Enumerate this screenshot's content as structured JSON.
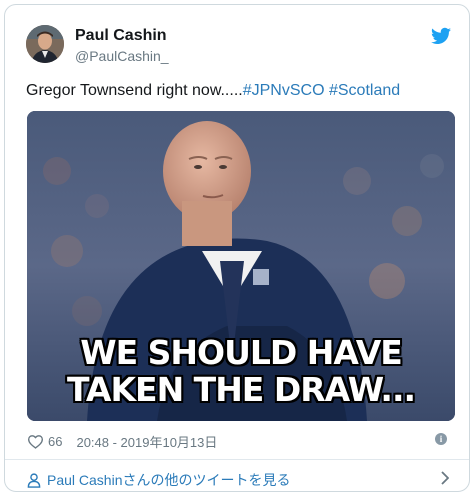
{
  "author": {
    "name": "Paul Cashin",
    "handle": "@PaulCashin_"
  },
  "tweet": {
    "text_prefix": "Gregor Townsend right now.....",
    "hashtag_1": "#JPNvSCO",
    "hashtag_2": "#Scotland"
  },
  "media": {
    "caption_line_1": "WE SHOULD HAVE",
    "caption_line_2": "TAKEN THE DRAW..."
  },
  "footer": {
    "likes": "66",
    "timestamp": "20:48 - 2019年10月13日",
    "more_tweets": "Paul Cashinさんの他のツイートを見る"
  },
  "colors": {
    "link": "#2b7bb9",
    "twitter_blue": "#1da1f2",
    "muted": "#697882"
  },
  "icons": [
    "twitter-bird-icon",
    "heart-icon",
    "info-icon",
    "person-icon",
    "chevron-right-icon"
  ]
}
